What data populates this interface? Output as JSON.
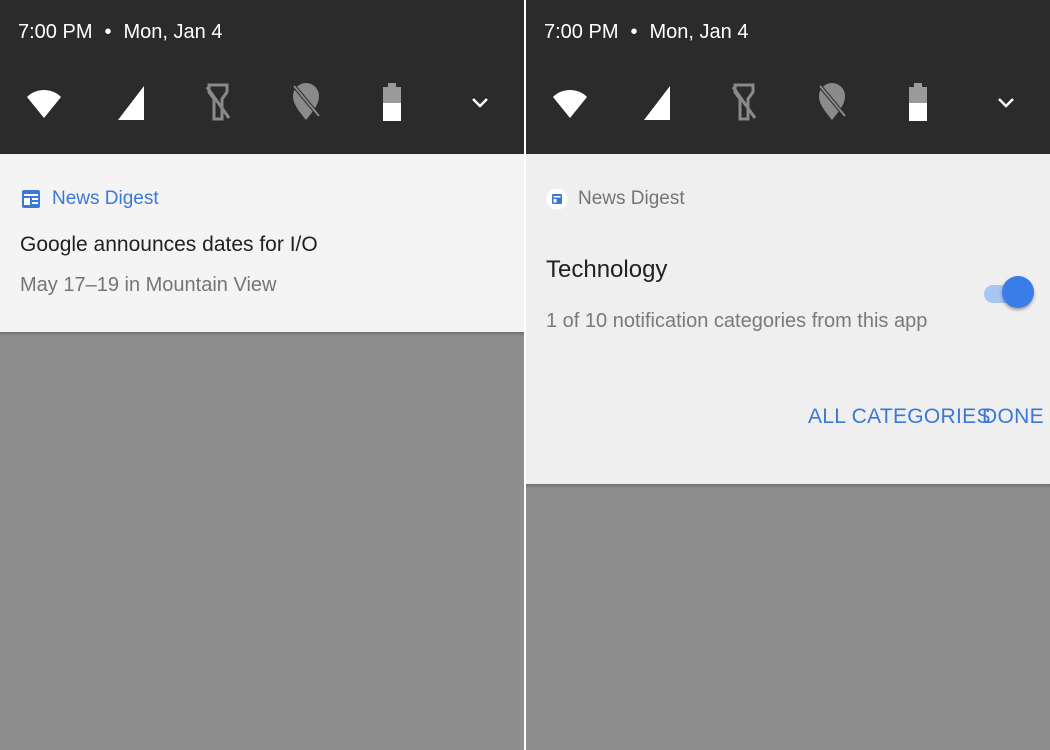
{
  "colors": {
    "quick_settings_bg": "#2b2b2b",
    "scrim": "#8d8d8d",
    "accent": "#3b78d8",
    "toggle_thumb": "#3b7de8",
    "toggle_track": "#a9c5f2"
  },
  "left": {
    "status": {
      "time": "7:00 PM",
      "separator": "•",
      "date": "Mon, Jan 4"
    },
    "tiles": [
      "wifi-icon",
      "cell-signal-icon",
      "flashlight-off-icon",
      "location-off-icon",
      "battery-icon",
      "chevron-down-icon"
    ],
    "notification": {
      "app_icon": "news-app-icon",
      "app_name": "News Digest",
      "title": "Google announces dates for I/O",
      "text": "May 17–19 in Mountain View"
    }
  },
  "right": {
    "status": {
      "time": "7:00 PM",
      "separator": "•",
      "date": "Mon, Jan 4"
    },
    "tiles": [
      "wifi-icon",
      "cell-signal-icon",
      "flashlight-off-icon",
      "location-off-icon",
      "battery-icon",
      "chevron-down-icon"
    ],
    "settings": {
      "app_icon": "news-app-icon",
      "app_name": "News Digest",
      "category_title": "Technology",
      "category_desc": "1 of 10 notification categories from this app",
      "toggle_on": true,
      "actions": {
        "all_categories": "ALL CATEGORIES",
        "done": "DONE"
      }
    }
  }
}
